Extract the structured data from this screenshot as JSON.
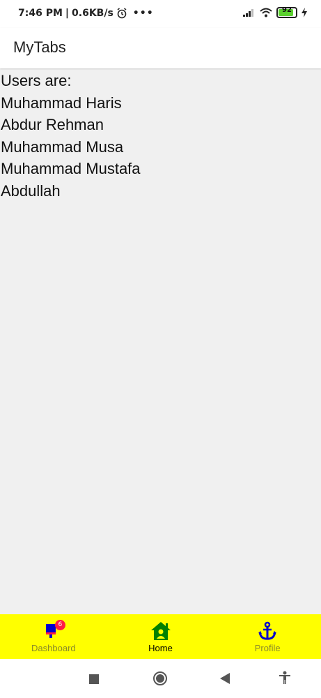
{
  "status_bar": {
    "time": "7:46 PM",
    "speed": "0.6KB/s",
    "battery": "92"
  },
  "app": {
    "title": "MyTabs"
  },
  "content": {
    "heading": "Users are:",
    "users": [
      "Muhammad Haris",
      "Abdur Rehman",
      "Muhammad Musa",
      "Muhammad Mustafa",
      "Abdullah"
    ]
  },
  "tabs": [
    {
      "label": "Dashboard",
      "icon": "dashboard-icon",
      "badge": "6",
      "active": false
    },
    {
      "label": "Home",
      "icon": "home-icon",
      "active": true
    },
    {
      "label": "Profile",
      "icon": "anchor-icon",
      "active": false
    }
  ],
  "colors": {
    "tab_bar_bg": "#ffff00",
    "home_icon": "#008000",
    "anchor_icon": "#0000cc",
    "badge": "#ff1a44"
  }
}
